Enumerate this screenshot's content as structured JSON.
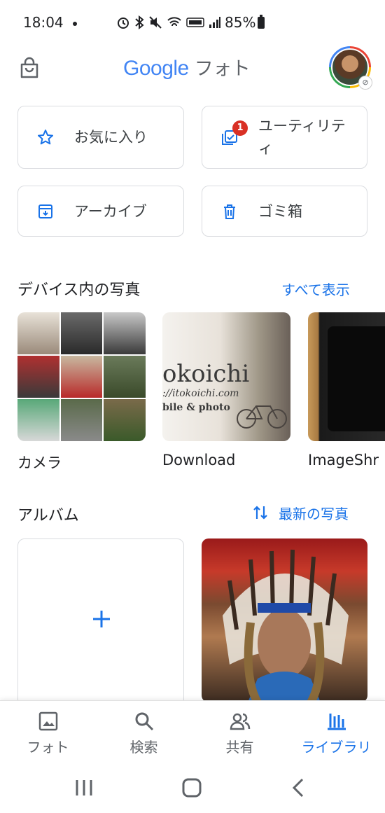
{
  "status_bar": {
    "time": "18:04",
    "battery": "85%"
  },
  "header": {
    "logo_text": "Google",
    "logo_suffix": "フォト"
  },
  "quick_tiles": [
    {
      "label": "お気に入り",
      "icon": "star-icon"
    },
    {
      "label": "ユーティリティ",
      "icon": "utility-icon",
      "badge": "1"
    },
    {
      "label": "アーカイブ",
      "icon": "archive-icon"
    },
    {
      "label": "ゴミ箱",
      "icon": "trash-icon"
    }
  ],
  "device_section": {
    "title": "デバイス内の写真",
    "link": "すべて表示",
    "folders": [
      {
        "label": "カメラ"
      },
      {
        "label": "Download",
        "thumb_text_main": "okoichi",
        "thumb_text_url": "://itokoichi.com",
        "thumb_text_sub": "bile & photo"
      },
      {
        "label": "ImageShr"
      }
    ]
  },
  "album_section": {
    "title": "アルバム",
    "sort_label": "最新の写真"
  },
  "bottom_nav": [
    {
      "label": "フォト",
      "icon": "photo-icon"
    },
    {
      "label": "検索",
      "icon": "search-icon"
    },
    {
      "label": "共有",
      "icon": "sharing-icon"
    },
    {
      "label": "ライブラリ",
      "icon": "library-icon",
      "active": true
    }
  ],
  "colors": {
    "accent": "#1a73e8",
    "badge": "#d93025",
    "text": "#202124"
  }
}
